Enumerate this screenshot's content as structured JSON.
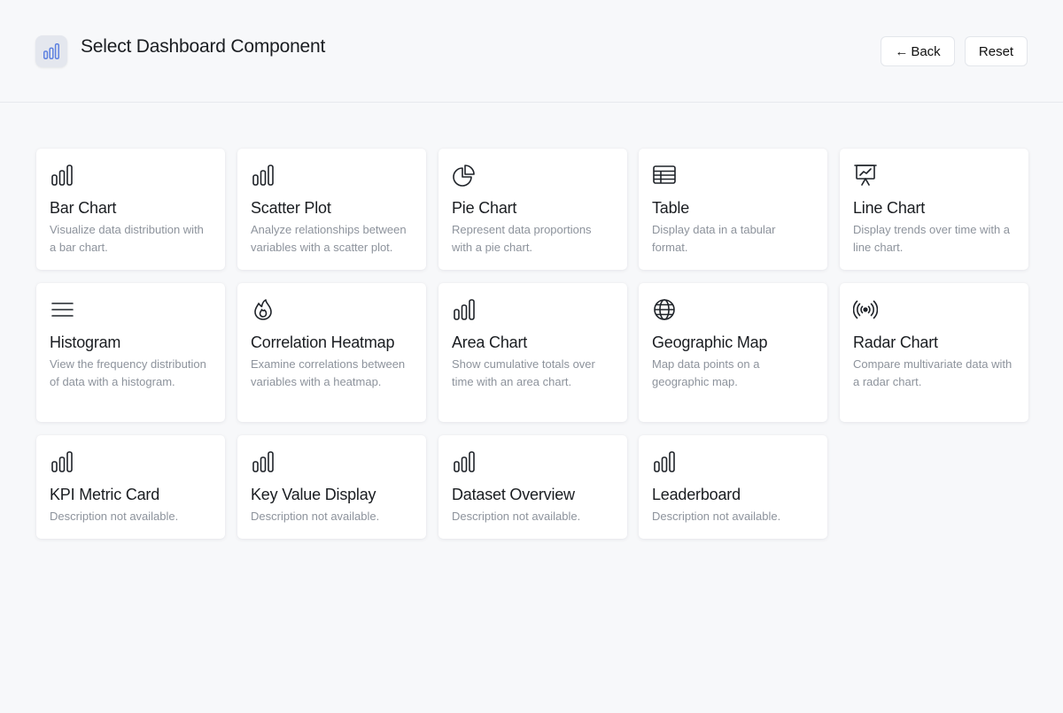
{
  "header": {
    "title": "Select Dashboard Component",
    "app_icon": "bar-chart-icon",
    "accent_color": "#5b7fe0",
    "back_label": "Back",
    "back_arrow": "←",
    "reset_label": "Reset"
  },
  "components": [
    {
      "icon": "bar-chart-icon",
      "title": "Bar Chart",
      "description": "Visualize data distribution with a bar chart."
    },
    {
      "icon": "bar-chart-icon",
      "title": "Scatter Plot",
      "description": "Analyze relationships between variables with a scatter plot."
    },
    {
      "icon": "pie-chart-icon",
      "title": "Pie Chart",
      "description": "Represent data proportions with a pie chart."
    },
    {
      "icon": "table-icon",
      "title": "Table",
      "description": "Display data in a tabular format."
    },
    {
      "icon": "presentation-chart-icon",
      "title": "Line Chart",
      "description": "Display trends over time with a line chart."
    },
    {
      "icon": "menu-lines-icon",
      "title": "Histogram",
      "description": "View the frequency distribution of data with a histogram."
    },
    {
      "icon": "fire-icon",
      "title": "Correlation Heatmap",
      "description": "Examine correlations between variables with a heatmap."
    },
    {
      "icon": "bar-chart-icon",
      "title": "Area Chart",
      "description": "Show cumulative totals over time with an area chart."
    },
    {
      "icon": "globe-icon",
      "title": "Geographic Map",
      "description": "Map data points on a geographic map."
    },
    {
      "icon": "signal-broadcast-icon",
      "title": "Radar Chart",
      "description": "Compare multivariate data with a radar chart."
    },
    {
      "icon": "bar-chart-icon",
      "title": "KPI Metric Card",
      "description": "Description not available."
    },
    {
      "icon": "bar-chart-icon",
      "title": "Key Value Display",
      "description": "Description not available."
    },
    {
      "icon": "bar-chart-icon",
      "title": "Dataset Overview",
      "description": "Description not available."
    },
    {
      "icon": "bar-chart-icon",
      "title": "Leaderboard",
      "description": "Description not available."
    }
  ]
}
